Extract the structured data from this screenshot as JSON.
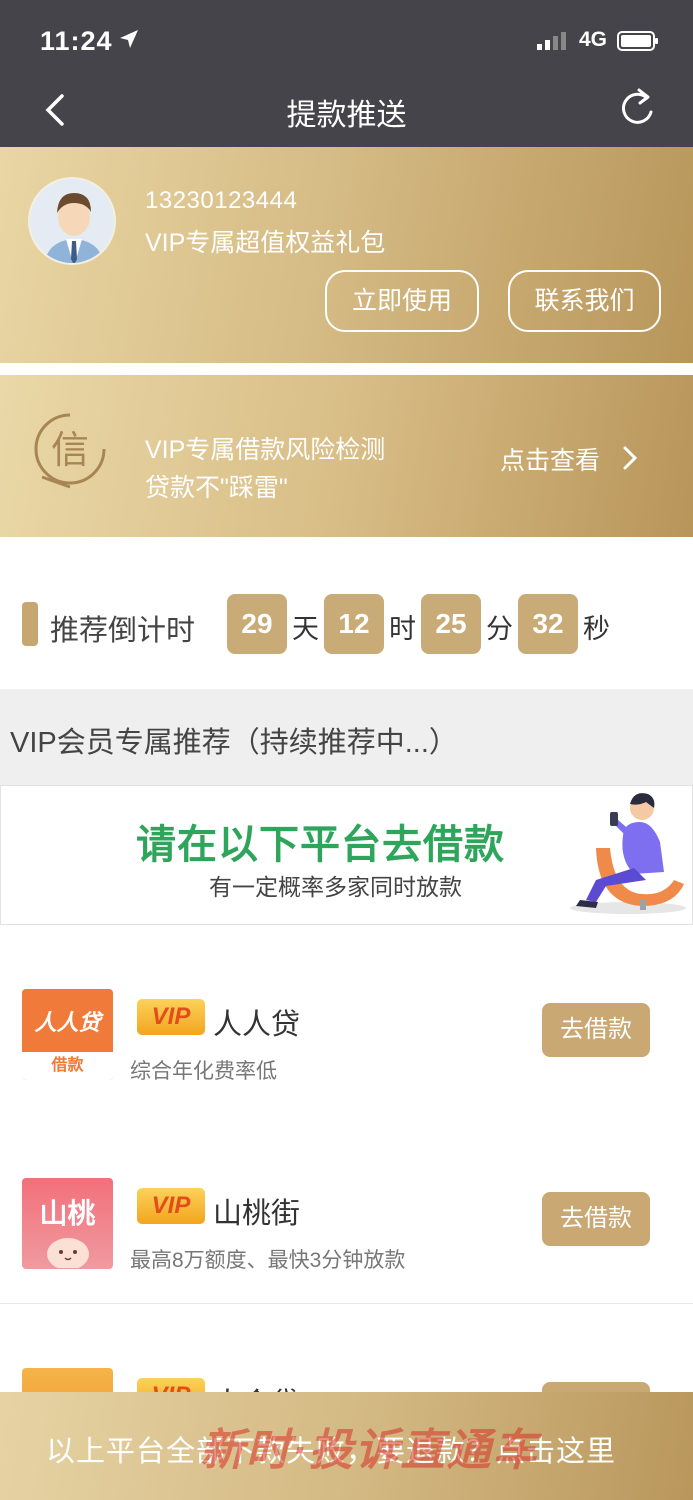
{
  "status_bar": {
    "time": "11:24",
    "network": "4G"
  },
  "nav": {
    "title": "提款推送"
  },
  "vip_card": {
    "phone": "13230123444",
    "subtitle": "VIP专属超值权益礼包",
    "use_button": "立即使用",
    "contact_button": "联系我们"
  },
  "risk_card": {
    "icon_char": "信",
    "line1": "VIP专属借款风险检测",
    "line2": "贷款不\"踩雷\"",
    "link": "点击查看"
  },
  "countdown": {
    "label": "推荐倒计时",
    "days": "29",
    "days_unit": "天",
    "hours": "12",
    "hours_unit": "时",
    "minutes": "25",
    "minutes_unit": "分",
    "seconds": "32",
    "seconds_unit": "秒"
  },
  "section": {
    "title": "VIP会员专属推荐（持续推荐中...）"
  },
  "banner": {
    "headline": "请在以下平台去借款",
    "subline": "有一定概率多家同时放款"
  },
  "platforms": [
    {
      "badge": "VIP",
      "name": "人人贷",
      "desc": "综合年化费率低",
      "button": "去借款",
      "logo_text": "人人贷",
      "logo_sub": "借款"
    },
    {
      "badge": "VIP",
      "name": "山桃街",
      "desc": "最高8万额度、最快3分钟放款",
      "button": "去借款",
      "logo_text": "山桃"
    },
    {
      "badge": "VIP",
      "name": "人会贷",
      "desc": "",
      "button": "去借款"
    }
  ],
  "footer": {
    "text": "以上平台全部下款失败，要退款？点击这里",
    "watermark": "新时·投诉直通车"
  },
  "colors": {
    "gold": "#c9a874",
    "nav_bg": "#44444a",
    "green": "#2ea55a"
  }
}
